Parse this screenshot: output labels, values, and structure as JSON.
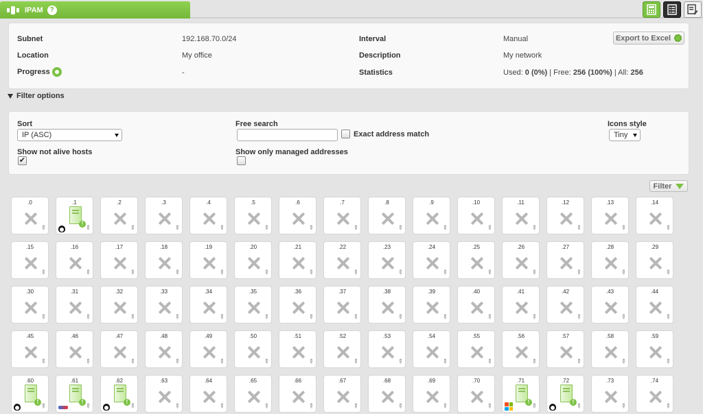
{
  "header": {
    "title": "IPAM",
    "help_glyph": "?"
  },
  "info": {
    "subnet_label": "Subnet",
    "subnet_value": "192.168.70.0/24",
    "location_label": "Location",
    "location_value": "My office",
    "progress_label": "Progress",
    "progress_value": "-",
    "interval_label": "Interval",
    "interval_value": "Manual",
    "description_label": "Description",
    "description_value": "My network",
    "statistics_label": "Statistics",
    "stats": {
      "used_label": "Used: ",
      "used_value": "0 (0%)",
      "free_label": " | Free: ",
      "free_value": "256 (100%)",
      "all_label": " | All: ",
      "all_value": "256"
    },
    "export_label": "Export to Excel"
  },
  "filter_toggle_label": "Filter options",
  "filters": {
    "sort_label": "Sort",
    "sort_value": "IP (ASC)",
    "free_search_label": "Free search",
    "free_search_value": "",
    "exact_match_label": "Exact address match",
    "icons_style_label": "Icons style",
    "icons_style_value": "Tiny",
    "show_not_alive_label": "Show not alive hosts",
    "show_not_alive_checked": true,
    "show_managed_label": "Show only managed addresses",
    "show_managed_checked": false,
    "filter_button_label": "Filter"
  },
  "hosts": [
    {
      "ip": ".0"
    },
    {
      "ip": ".1",
      "alive": true,
      "os": "linux"
    },
    {
      "ip": ".2"
    },
    {
      "ip": ".3"
    },
    {
      "ip": ".4"
    },
    {
      "ip": ".5"
    },
    {
      "ip": ".6"
    },
    {
      "ip": ".7"
    },
    {
      "ip": ".8"
    },
    {
      "ip": ".9"
    },
    {
      "ip": ".10"
    },
    {
      "ip": ".11"
    },
    {
      "ip": ".12"
    },
    {
      "ip": ".13"
    },
    {
      "ip": ".14"
    },
    {
      "ip": ".15"
    },
    {
      "ip": ".16"
    },
    {
      "ip": ".17"
    },
    {
      "ip": ".18"
    },
    {
      "ip": ".19"
    },
    {
      "ip": ".20"
    },
    {
      "ip": ".21"
    },
    {
      "ip": ".22"
    },
    {
      "ip": ".23"
    },
    {
      "ip": ".24"
    },
    {
      "ip": ".25"
    },
    {
      "ip": ".26"
    },
    {
      "ip": ".27"
    },
    {
      "ip": ".28"
    },
    {
      "ip": ".29"
    },
    {
      "ip": ".30"
    },
    {
      "ip": ".31"
    },
    {
      "ip": ".32"
    },
    {
      "ip": ".33"
    },
    {
      "ip": ".34"
    },
    {
      "ip": ".35"
    },
    {
      "ip": ".36"
    },
    {
      "ip": ".37"
    },
    {
      "ip": ".38"
    },
    {
      "ip": ".39"
    },
    {
      "ip": ".40"
    },
    {
      "ip": ".41"
    },
    {
      "ip": ".42"
    },
    {
      "ip": ".43"
    },
    {
      "ip": ".44"
    },
    {
      "ip": ".45"
    },
    {
      "ip": ".46"
    },
    {
      "ip": ".47"
    },
    {
      "ip": ".48"
    },
    {
      "ip": ".49"
    },
    {
      "ip": ".50"
    },
    {
      "ip": ".51"
    },
    {
      "ip": ".52"
    },
    {
      "ip": ".53"
    },
    {
      "ip": ".54"
    },
    {
      "ip": ".55"
    },
    {
      "ip": ".56"
    },
    {
      "ip": ".57"
    },
    {
      "ip": ".58"
    },
    {
      "ip": ".59"
    },
    {
      "ip": ".60",
      "alive": true,
      "os": "linux"
    },
    {
      "ip": ".61",
      "alive": true,
      "os": "other"
    },
    {
      "ip": ".62",
      "alive": true,
      "os": "linux"
    },
    {
      "ip": ".63"
    },
    {
      "ip": ".64"
    },
    {
      "ip": ".65"
    },
    {
      "ip": ".66"
    },
    {
      "ip": ".67"
    },
    {
      "ip": ".68"
    },
    {
      "ip": ".69"
    },
    {
      "ip": ".70"
    },
    {
      "ip": ".71",
      "alive": true,
      "os": "windows"
    },
    {
      "ip": ".72",
      "alive": true,
      "os": "linux"
    },
    {
      "ip": ".73"
    },
    {
      "ip": ".74"
    }
  ],
  "colors": {
    "accent": "#7cc243",
    "background": "#e4e4e4",
    "panel": "#f9f9f9"
  }
}
